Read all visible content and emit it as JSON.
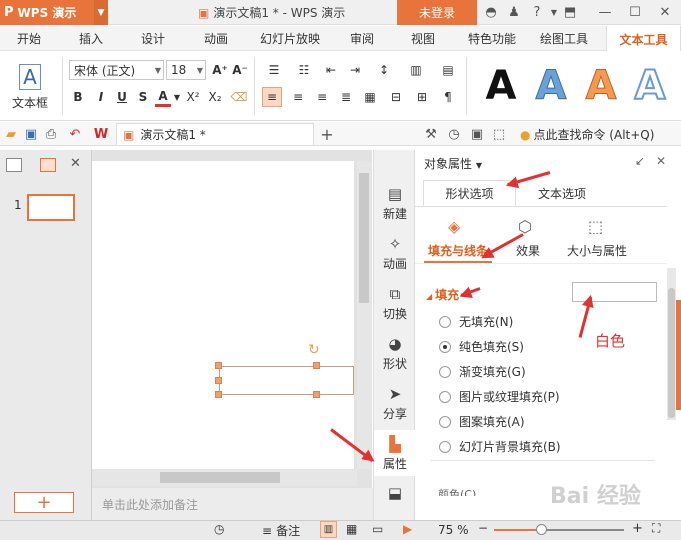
{
  "app": {
    "logo": "P",
    "name": "WPS 演示",
    "doc_title": "演示文稿1 * - WPS 演示",
    "login": "未登录"
  },
  "tabs": [
    "开始",
    "插入",
    "设计",
    "动画",
    "幻灯片放映",
    "审阅",
    "视图",
    "特色功能",
    "绘图工具",
    "文本工具"
  ],
  "ribbon": {
    "textbox_label": "文本框",
    "font_name": "宋体 (正文)",
    "font_size": "18",
    "bold": "B",
    "italic": "I",
    "underline": "U",
    "strike": "S",
    "color": "A",
    "sup": "X²",
    "sub": "X₂",
    "wordart_samples": [
      "A",
      "A",
      "A",
      "A"
    ]
  },
  "quickbar": {
    "doc_tab": "演示文稿1 *",
    "add_tab": "+",
    "search": "点此查找命令 (Alt+Q)"
  },
  "slides": {
    "number": "1",
    "add": "+"
  },
  "notes_placeholder": "单击此处添加备注",
  "sidebar": {
    "items": [
      "新建",
      "动画",
      "切换",
      "形状",
      "分享",
      "属性",
      "备份"
    ]
  },
  "panel": {
    "title": "对象属性",
    "tabs": [
      "形状选项",
      "文本选项"
    ],
    "subtabs": [
      "填充与线条",
      "效果",
      "大小与属性"
    ],
    "section": "填充",
    "options": [
      "无填充(N)",
      "纯色填充(S)",
      "渐变填充(G)",
      "图片或纹理填充(P)",
      "图案填充(A)",
      "幻灯片背景填充(B)"
    ],
    "selected_option": "纯色填充(S)",
    "color_label": "颜色(C)",
    "annotation": "白色"
  },
  "status": {
    "notes": "备注",
    "zoom": "75 %"
  },
  "watermark": "Bai 经验",
  "colors": {
    "accent": "#e8743b",
    "arrow": "#e23131"
  }
}
